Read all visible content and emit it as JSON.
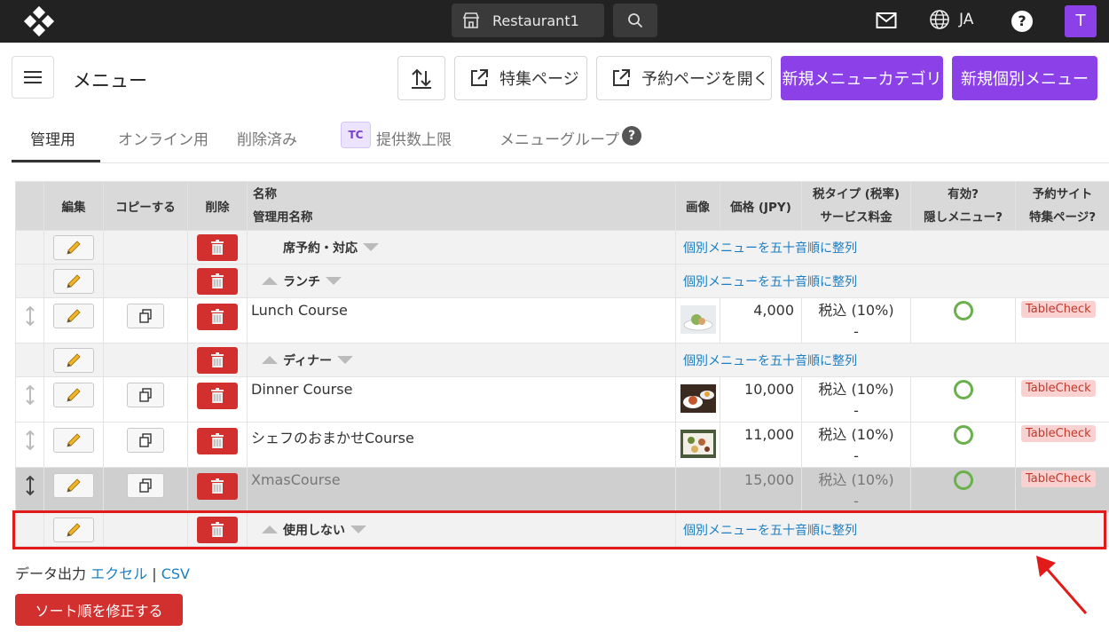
{
  "topbar": {
    "store_name": "Restaurant1",
    "language": "JA",
    "help_label": "?",
    "user_initial": "T"
  },
  "header": {
    "title": "メニュー",
    "buttons": {
      "feature_page": "特集ページ",
      "open_reservation": "予約ページを開く",
      "new_category": "新規メニューカテゴリ",
      "new_item": "新規個別メニュー"
    }
  },
  "tabs": {
    "management": "管理用",
    "online": "オンライン用",
    "deleted": "削除済み",
    "tc_badge": "TC",
    "capacity": "提供数上限",
    "menu_group": "メニューグループ",
    "help": "?"
  },
  "table": {
    "headers": {
      "edit": "編集",
      "copy": "コピーする",
      "delete": "削除",
      "name": "名称",
      "admin_name": "管理用名称",
      "image": "画像",
      "price": "価格 (JPY)",
      "tax_type": "税タイプ (税率)",
      "service_fee": "サービス料金",
      "active": "有効?",
      "hidden": "隠しメニュー?",
      "booking_site": "予約サイト",
      "feature_page": "特集ページ?"
    },
    "sort_link": "個別メニューを五十音順に整列",
    "rows": {
      "cat1": "席予約・対応",
      "cat2": "ランチ",
      "item1": {
        "name": "Lunch Course",
        "price": "4,000",
        "tax": "税込 (10%)",
        "service": "-",
        "site": "TableCheck"
      },
      "cat3": "ディナー",
      "item2": {
        "name": "Dinner Course",
        "price": "10,000",
        "tax": "税込 (10%)",
        "service": "-",
        "site": "TableCheck"
      },
      "item3": {
        "name": "シェフのおまかせCourse",
        "price": "11,000",
        "tax": "税込 (10%)",
        "service": "-",
        "site": "TableCheck"
      },
      "item4": {
        "name": "XmasCourse",
        "price": "15,000",
        "tax": "税込 (10%)",
        "service": "-",
        "site": "TableCheck"
      },
      "cat4": "使用しない"
    }
  },
  "footer": {
    "export_label": "データ出力",
    "excel": "エクセル",
    "separator": "|",
    "csv": "CSV",
    "fix_sort": "ソート順を修正する"
  },
  "colors": {
    "accent": "#8c40e8",
    "danger": "#d22f2f",
    "link": "#1a7ec4",
    "highlight": "#e21a1a"
  }
}
